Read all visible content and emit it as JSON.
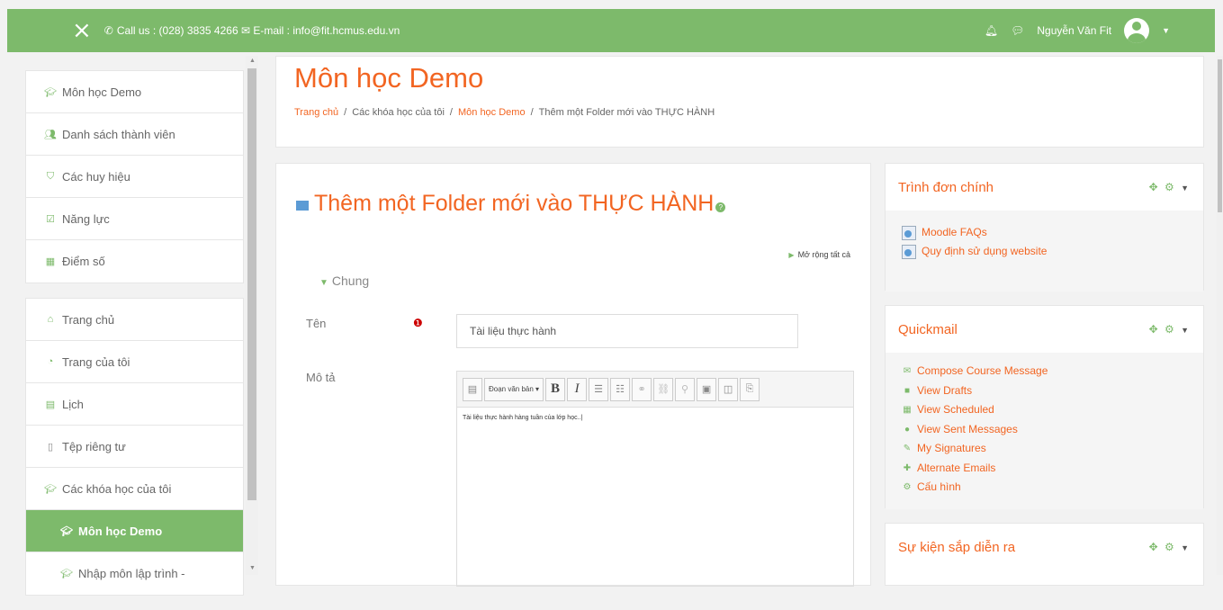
{
  "topbar": {
    "close_icon": "×",
    "contact": "Call us : (028) 3835 4266 ✉ E-mail : info@fit.hcmus.edu.vn",
    "user_name": "Nguyễn Văn Fit"
  },
  "sidebar": {
    "group1": [
      {
        "icon": "graduation-cap-icon",
        "label": "Môn học Demo"
      },
      {
        "icon": "users-icon",
        "label": "Danh sách thành viên"
      },
      {
        "icon": "shield-icon",
        "label": "Các huy hiệu"
      },
      {
        "icon": "check-square-icon",
        "label": "Năng lực"
      },
      {
        "icon": "table-icon",
        "label": "Điểm số"
      }
    ],
    "group2": [
      {
        "icon": "home-icon",
        "label": "Trang chủ"
      },
      {
        "icon": "dashboard-icon",
        "label": "Trang của tôi"
      },
      {
        "icon": "calendar-icon",
        "label": "Lịch"
      },
      {
        "icon": "file-icon",
        "label": "Tệp riêng tư"
      },
      {
        "icon": "graduation-cap-icon",
        "label": "Các khóa học của tôi"
      },
      {
        "icon": "graduation-cap-icon",
        "label": "Môn học Demo"
      },
      {
        "icon": "graduation-cap-icon",
        "label": "Nhập môn lập trình -"
      }
    ]
  },
  "header": {
    "title": "Môn học Demo",
    "breadcrumb": [
      "Trang chủ",
      "Các khóa học của tôi",
      "Môn học Demo",
      "Thêm một Folder mới vào THỰC HÀNH"
    ]
  },
  "form": {
    "title": "Thêm một Folder mới vào THỰC HÀNH",
    "expand_all": "Mở rộng tất cả",
    "section": "Chung",
    "name_label": "Tên",
    "name_value": "Tài liệu thực hành",
    "desc_label": "Mô tả",
    "paragraph_select": "Đoạn văn bản ▾",
    "desc_value": "Tài liệu thực hành hàng tuần của lớp học..|"
  },
  "blocks": {
    "main_menu": {
      "title": "Trình đơn chính",
      "links": [
        "Moodle FAQs",
        "Quy định sử dụng website"
      ]
    },
    "quickmail": {
      "title": "Quickmail",
      "links": [
        "Compose Course Message",
        "View Drafts",
        "View Scheduled",
        "View Sent Messages",
        "My Signatures",
        "Alternate Emails",
        "Cấu hình"
      ]
    },
    "events": {
      "title": "Sự kiện sắp diễn ra"
    }
  },
  "colors": {
    "accent": "#7dba6b",
    "link": "#f26522"
  }
}
